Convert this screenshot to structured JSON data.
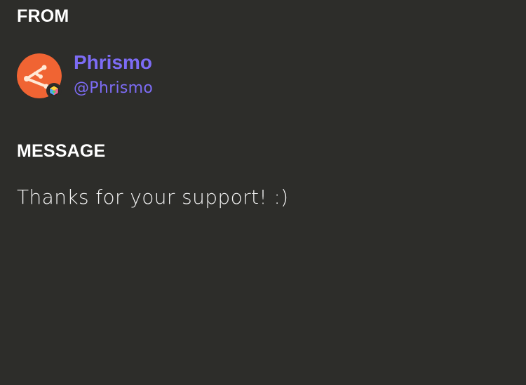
{
  "from": {
    "title": "FROM",
    "sender": {
      "name": "Phrismo",
      "handle": "@Phrismo",
      "avatar_icon": "phrismo-logo-icon",
      "badge_icon": "cube-badge-icon",
      "name_color": "#7d6cf5",
      "avatar_bg": "#f06433"
    }
  },
  "message": {
    "title": "MESSAGE",
    "body": "Thanks for your support! :)"
  }
}
